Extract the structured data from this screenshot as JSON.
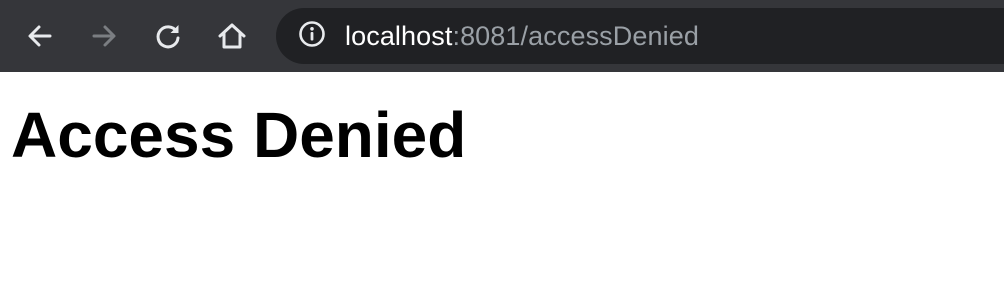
{
  "browser": {
    "toolbar_color": "#35363a",
    "omnibox_color": "#202124",
    "nav": {
      "back_icon": "arrow-left-icon",
      "forward_icon": "arrow-right-icon",
      "reload_icon": "reload-icon",
      "home_icon": "home-icon"
    },
    "address_bar": {
      "security_icon": "info-circle-icon",
      "host": "localhost",
      "rest": ":8081/accessDenied",
      "host_color": "#ffffff",
      "rest_color": "#9aa0a6"
    }
  },
  "page": {
    "heading": "Access Denied"
  }
}
